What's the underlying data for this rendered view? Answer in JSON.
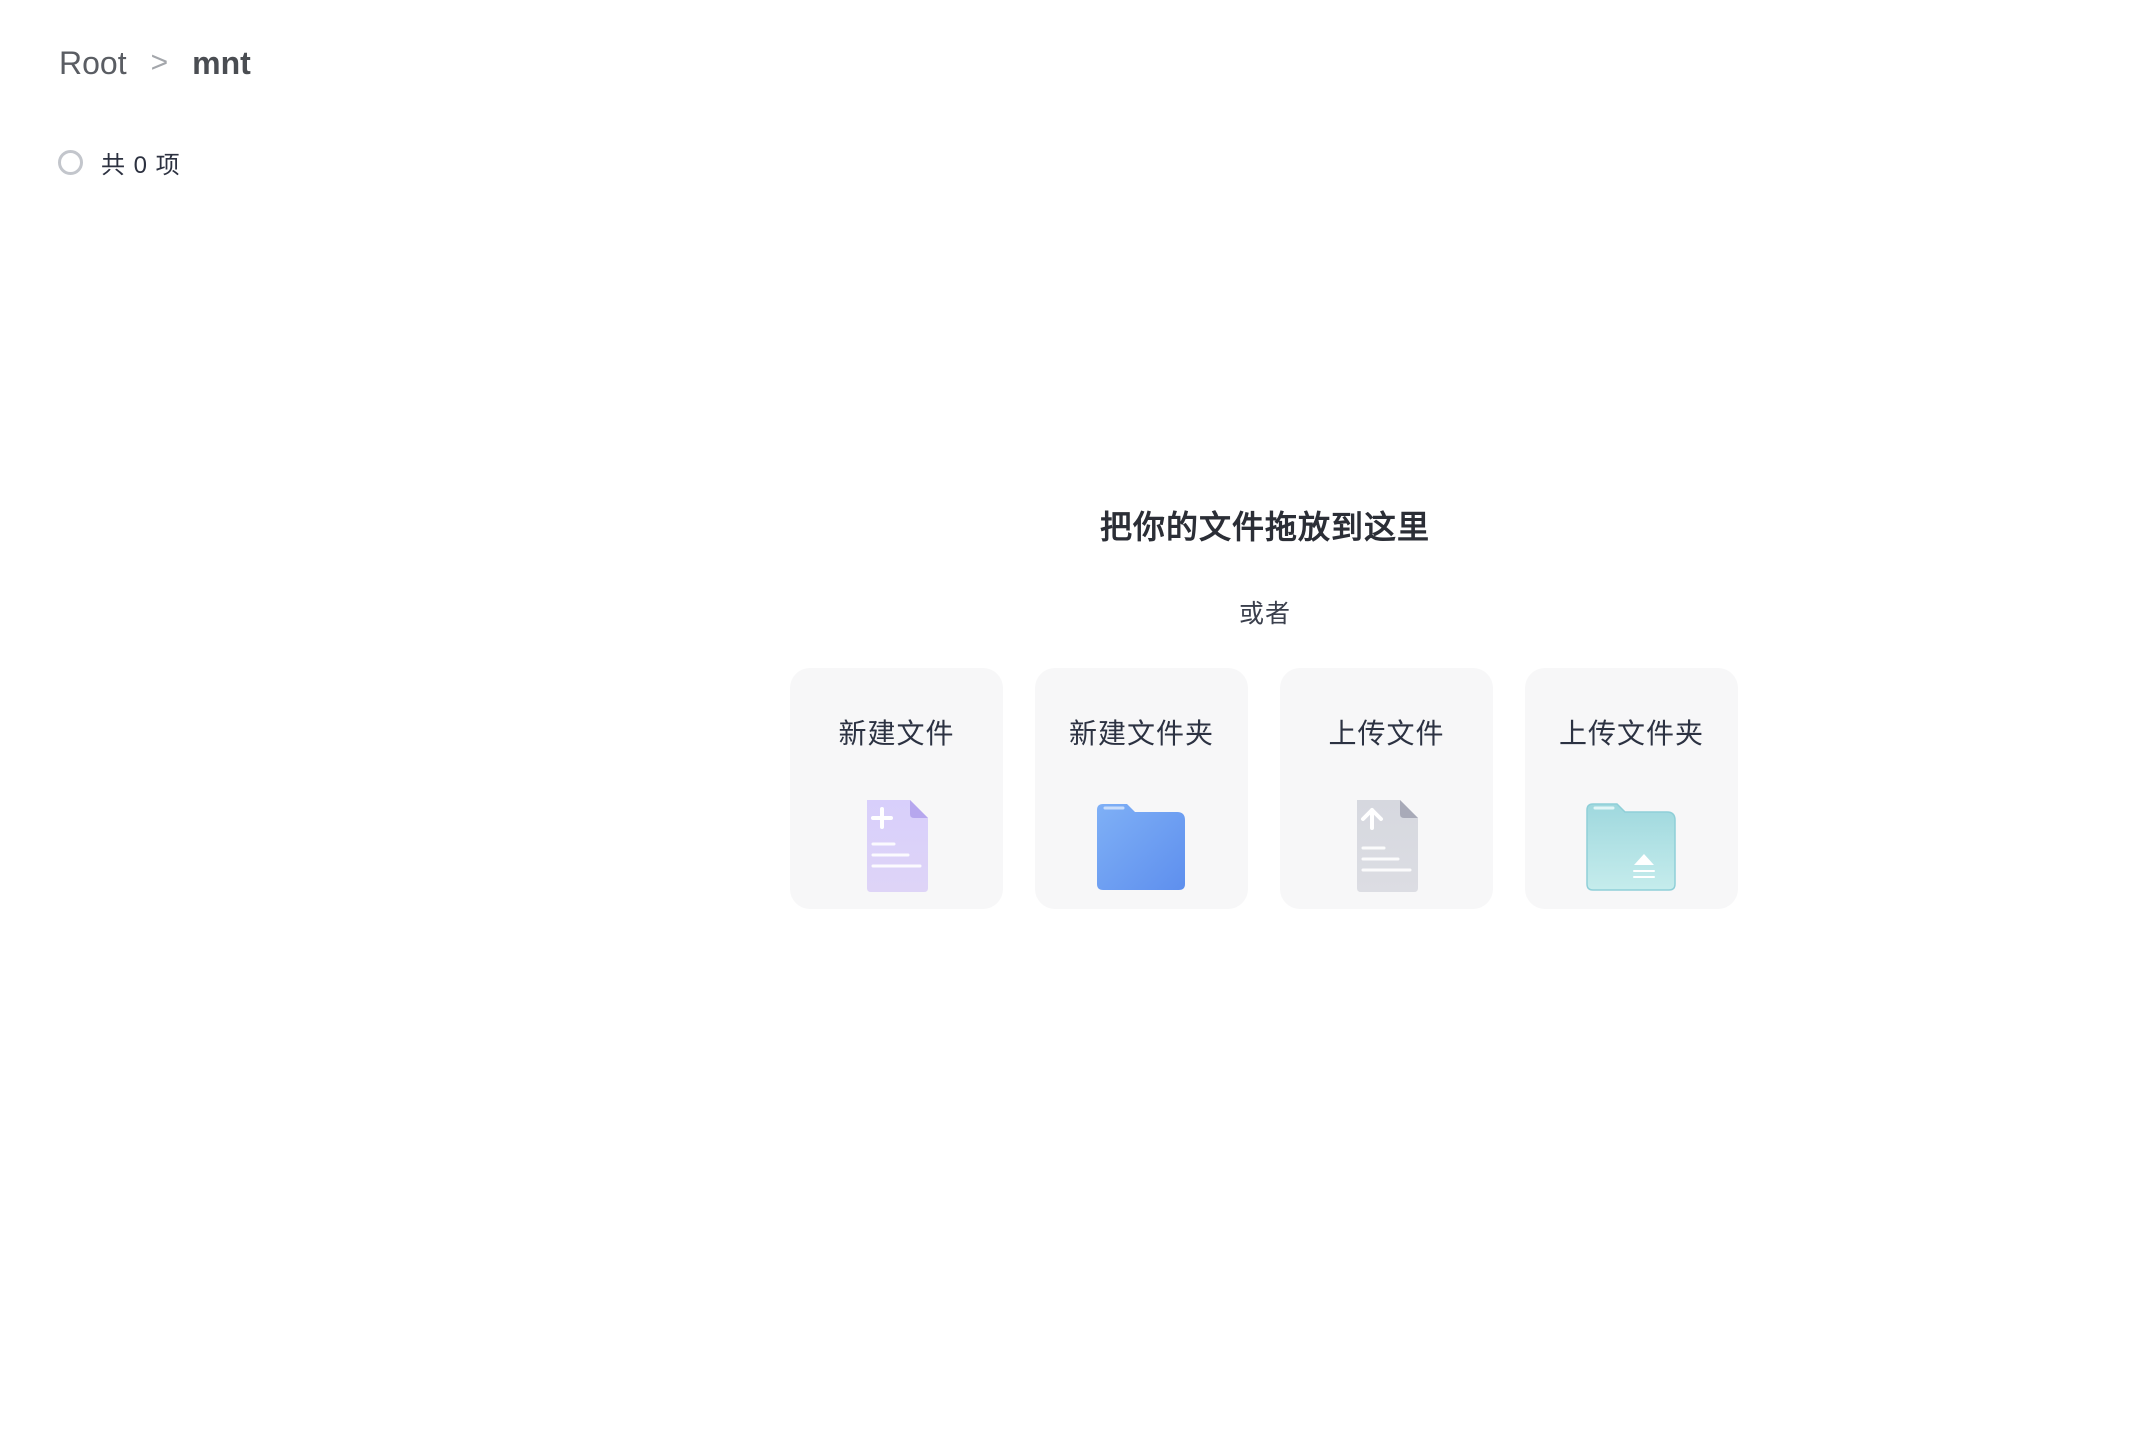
{
  "breadcrumb": {
    "root": "Root",
    "separator": ">",
    "current": "mnt"
  },
  "list": {
    "count_label": "共 0 项"
  },
  "dropzone": {
    "title": "把你的文件拖放到这里",
    "or": "或者",
    "actions": [
      {
        "label": "新建文件",
        "icon": "new-file-icon",
        "color": "#c9bff7"
      },
      {
        "label": "新建文件夹",
        "icon": "folder-icon",
        "color": "#6f9df2"
      },
      {
        "label": "上传文件",
        "icon": "upload-file-icon",
        "color": "#cfd1d9"
      },
      {
        "label": "上传文件夹",
        "icon": "upload-folder-icon",
        "color": "#a9dfe3"
      }
    ]
  }
}
